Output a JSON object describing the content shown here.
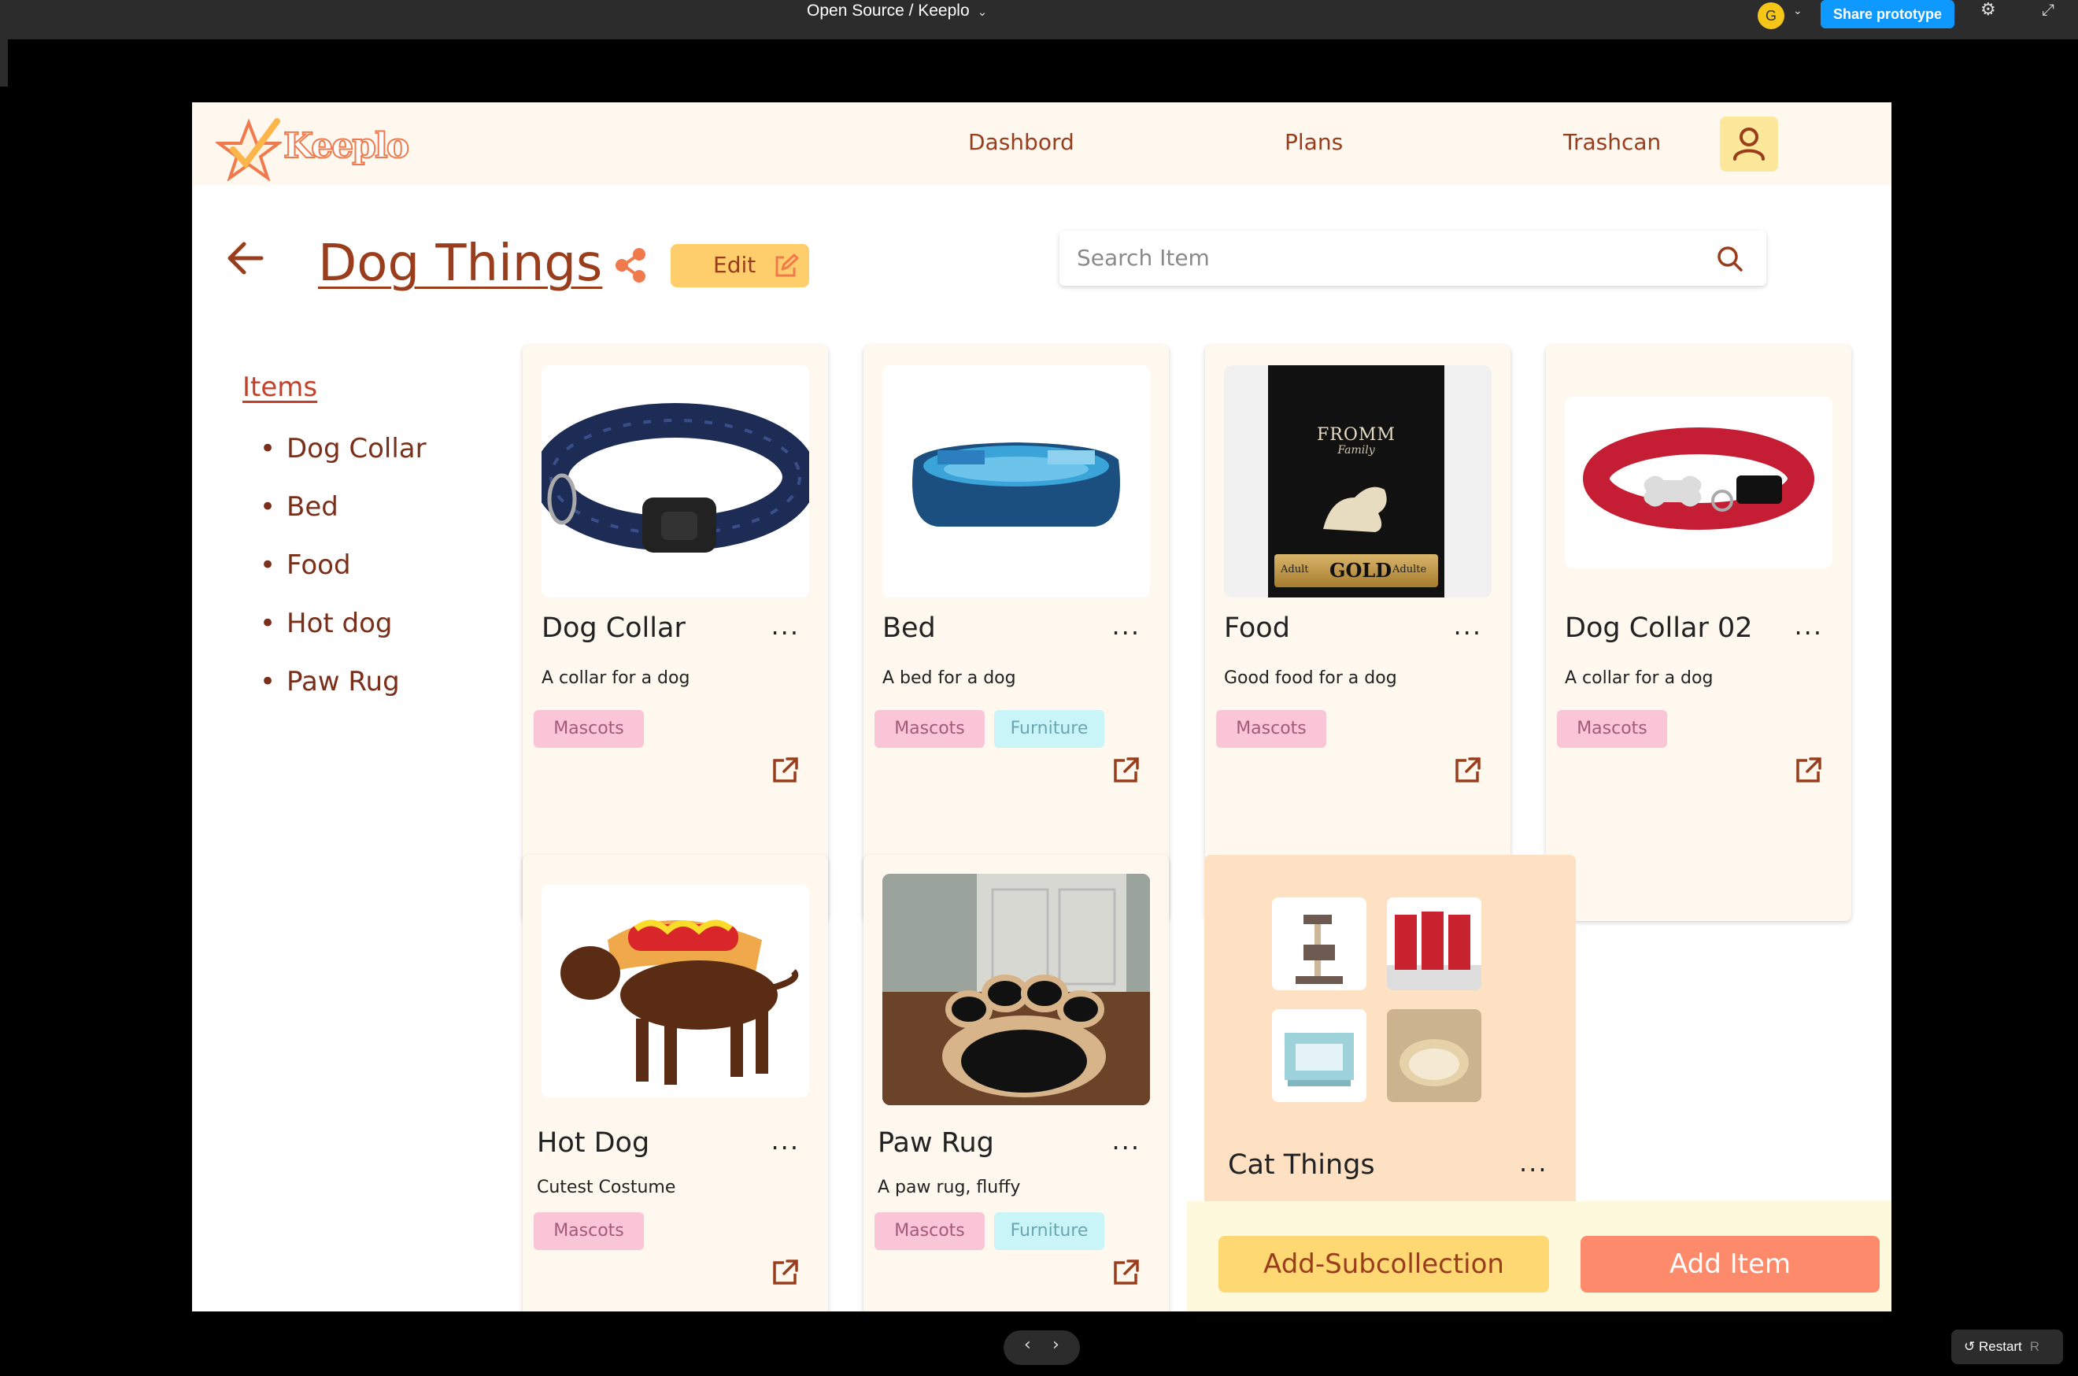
{
  "figma": {
    "project_title": "Open Source / Keeplo",
    "user_initial": "G",
    "share_label": "Share prototype",
    "restart_label": "Restart",
    "restart_key": "R"
  },
  "app": {
    "logo_text": "Keeplo",
    "nav": [
      "Dashbord",
      "Plans",
      "Trashcan"
    ],
    "page_title": "Dog Things",
    "edit_label": "Edit",
    "search_placeholder": "Search Item",
    "items_heading": "Items",
    "items": [
      "Dog Collar",
      "Bed",
      "Food",
      "Hot dog",
      "Paw Rug"
    ],
    "cards": [
      {
        "title": "Dog Collar",
        "desc": "A collar for a dog",
        "tags": [
          "Mascots"
        ],
        "image": "dog-collar-image"
      },
      {
        "title": "Bed",
        "desc": "A bed for a dog",
        "tags": [
          "Mascots",
          "Furniture"
        ],
        "image": "dog-bed-image"
      },
      {
        "title": "Food",
        "desc": "Good food for a dog",
        "tags": [
          "Mascots"
        ],
        "image": "dog-food-bag-image"
      },
      {
        "title": "Dog Collar 02",
        "desc": "A collar for a dog",
        "tags": [
          "Mascots"
        ],
        "image": "red-collar-image"
      },
      {
        "title": "Hot Dog",
        "desc": "Cutest Costume",
        "tags": [
          "Mascots"
        ],
        "image": "hot-dog-costume-image"
      },
      {
        "title": "Paw Rug",
        "desc": "A paw rug, fluffy",
        "tags": [
          "Mascots",
          "Furniture"
        ],
        "image": "paw-rug-image"
      }
    ],
    "subcollection": {
      "title": "Cat Things"
    },
    "menu_glyph": "...",
    "add_subcollection_label": "Add-Subcollection",
    "add_item_label": "Add Item",
    "food_bag": {
      "brand": "FROMM",
      "line": "Family",
      "grade": "GOLD",
      "left_badge": "Adult",
      "right_badge": "Adulte"
    }
  },
  "colors": {
    "brand_brown": "#9a3d1c",
    "header_bg": "#fef8ef",
    "edit_yellow": "#fece6c",
    "add_item_coral": "#fd8b6b",
    "mascots_tag": "#f9c5d7",
    "furniture_tag": "#c9f5f8"
  }
}
